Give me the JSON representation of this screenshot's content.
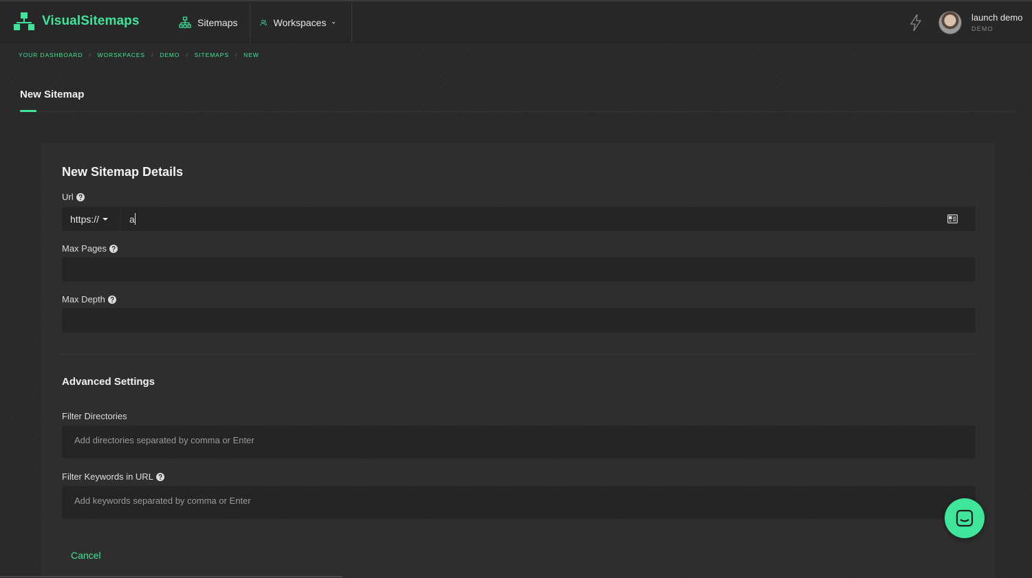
{
  "brand": {
    "name": "VisualSitemaps",
    "accent": "#3ee59a"
  },
  "nav": {
    "sitemaps": "Sitemaps",
    "workspaces": "Workspaces"
  },
  "user": {
    "name": "launch demo",
    "role": "DEMO"
  },
  "breadcrumb": [
    "YOUR DASHBOARD",
    "WORSKPACES",
    "DEMO",
    "SITEMAPS",
    "NEW"
  ],
  "page": {
    "title": "New Sitemap"
  },
  "form": {
    "title": "New Sitemap Details",
    "url": {
      "label": "Url",
      "protocol": "https://",
      "value": "a"
    },
    "max_pages": {
      "label": "Max Pages",
      "value": ""
    },
    "max_depth": {
      "label": "Max Depth",
      "value": ""
    },
    "advanced": {
      "title": "Advanced Settings",
      "filter_directories": {
        "label": "Filter Directories",
        "placeholder": "Add directories separated by comma or Enter"
      },
      "filter_keywords": {
        "label": "Filter Keywords in URL",
        "placeholder": "Add keywords separated by comma or Enter"
      }
    },
    "cancel_label": "Cancel"
  },
  "icons": {
    "logo": "sitemap-logo-icon",
    "sitemaps": "sitemap-tree-icon",
    "workspaces": "users-icon",
    "bolt": "lightning-icon",
    "help": "question-circle-icon",
    "contact": "address-card-icon",
    "chat": "chat-icon"
  }
}
